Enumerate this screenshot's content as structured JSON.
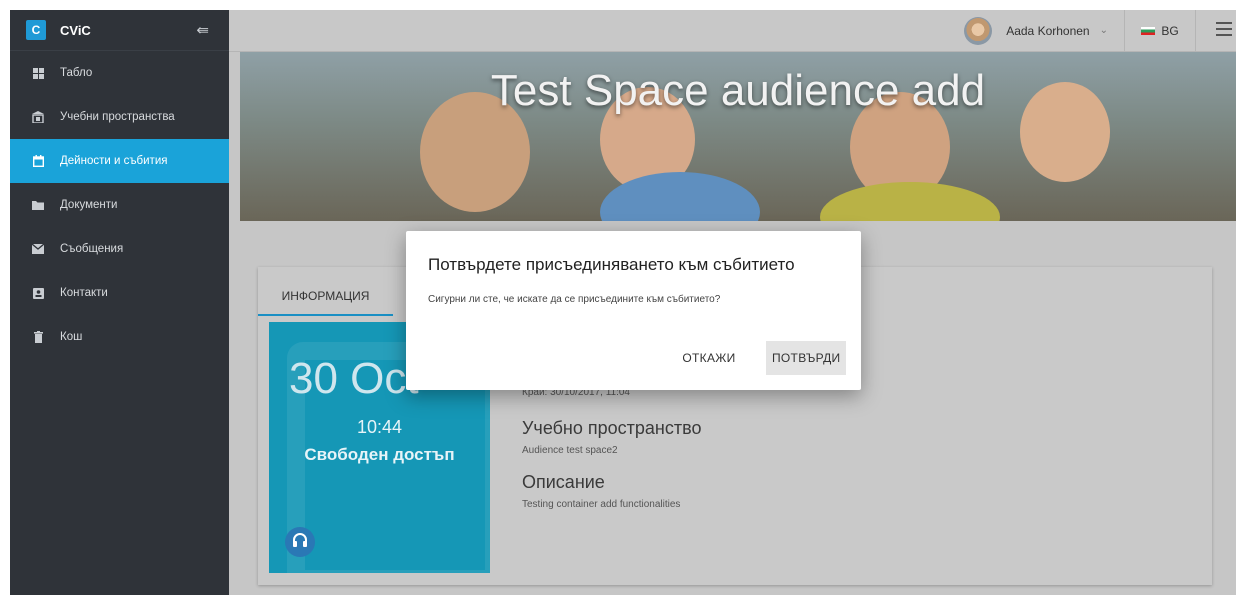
{
  "app": {
    "logo_letter": "C",
    "name": "CViC",
    "collapse_glyph": "⇚"
  },
  "sidebar": {
    "items": [
      {
        "label": "Табло",
        "icon": "grid-icon",
        "active": false
      },
      {
        "label": "Учебни пространства",
        "icon": "building-icon",
        "active": false
      },
      {
        "label": "Дейности и събития",
        "icon": "calendar-icon",
        "active": true
      },
      {
        "label": "Документи",
        "icon": "folder-icon",
        "active": false
      },
      {
        "label": "Съобщения",
        "icon": "envelope-icon",
        "active": false
      },
      {
        "label": "Контакти",
        "icon": "contact-card-icon",
        "active": false
      },
      {
        "label": "Кош",
        "icon": "trash-icon",
        "active": false
      }
    ]
  },
  "header": {
    "user_name": "Aada Korhonen",
    "lang": "BG"
  },
  "hero": {
    "title": "Test Space audience add"
  },
  "event": {
    "tab_info": "ИНФОРМАЦИЯ",
    "date": "30 Oct",
    "time": "10:44",
    "access": "Свободен достъп",
    "end_label": "Край: 30/10/2017, 11:04",
    "space_title": "Учебно пространство",
    "space_value": "Audience test space2",
    "desc_title": "Описание",
    "desc_value": "Testing container add functionalities"
  },
  "dialog": {
    "title": "Потвърдете присъединяването към събитието",
    "message": "Сигурни ли сте, че искате да се присъедините към събитието?",
    "cancel_label": "ОТКАЖИ",
    "confirm_label": "ПОТВЪРДИ"
  },
  "colors": {
    "accent": "#1aa3d9",
    "sidebar_bg": "#2f3339",
    "tile_bg": "#1597b6"
  }
}
